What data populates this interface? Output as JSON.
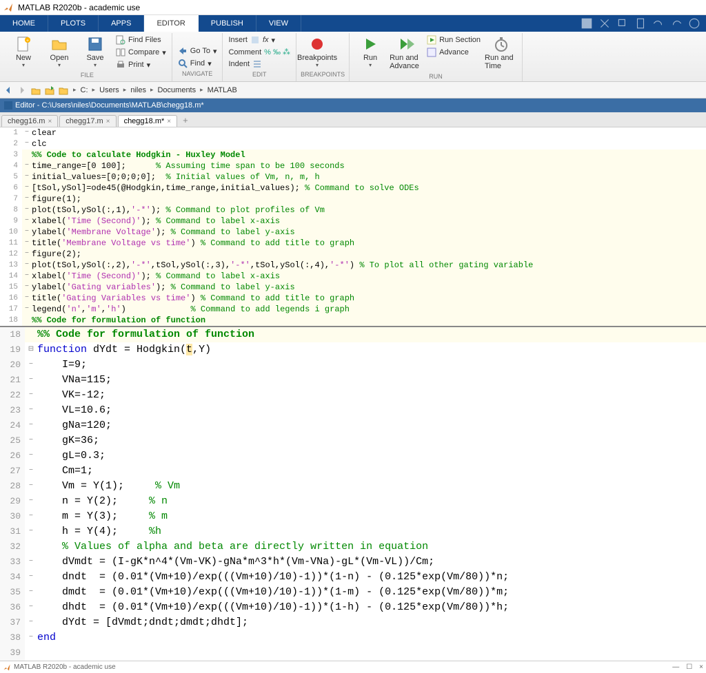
{
  "window": {
    "title": "MATLAB R2020b - academic use"
  },
  "tabs": {
    "home": "HOME",
    "plots": "PLOTS",
    "apps": "APPS",
    "editor": "EDITOR",
    "publish": "PUBLISH",
    "view": "VIEW"
  },
  "ribbon": {
    "new": "New",
    "open": "Open",
    "save": "Save",
    "findfiles": "Find Files",
    "compare": "Compare",
    "print": "Print",
    "goto": "Go To",
    "find": "Find",
    "comment": "Comment",
    "indent": "Indent",
    "insert": "Insert",
    "breakpoints": "Breakpoints",
    "run": "Run",
    "runadvance": "Run and Advance",
    "runsection": "Run Section",
    "advance": "Advance",
    "runtime": "Run and Time",
    "g_file": "FILE",
    "g_navigate": "NAVIGATE",
    "g_edit": "EDIT",
    "g_breakpoints": "BREAKPOINTS",
    "g_run": "RUN"
  },
  "breadcrumb": {
    "c": "C:",
    "users": "Users",
    "niles": "niles",
    "documents": "Documents",
    "matlab": "MATLAB"
  },
  "editorbar": "Editor - C:\\Users\\niles\\Documents\\MATLAB\\chegg18.m*",
  "filetabs": {
    "t1": "chegg16.m",
    "t2": "chegg17.m",
    "t3": "chegg18.m*"
  },
  "code1": {
    "l1": "clear",
    "l2": "clc",
    "l3": "%% Code to calculate Hodgkin - Huxley Model",
    "l4a": "time_range=[0 100];      ",
    "l4b": "% Assuming time span to be 100 seconds",
    "l5a": "initial_values=[0;0;0;0];  ",
    "l5b": "% Initial values of Vm, n, m, h",
    "l6a": "[tSol,ySol]=ode45(@Hodgkin,time_range,initial_values); ",
    "l6b": "% Command to solve ODEs",
    "l7": "figure(1);",
    "l8a": "plot(tSol,ySol(:,1),",
    "l8s": "'-*'",
    "l8b": "); ",
    "l8c": "% Command to plot profiles of Vm",
    "l9a": "xlabel(",
    "l9s": "'Time (Second)'",
    "l9b": "); ",
    "l9c": "% Command to label x-axis",
    "l10a": "ylabel(",
    "l10s": "'Membrane Voltage'",
    "l10b": "); ",
    "l10c": "% Command to label y-axis",
    "l11a": "title(",
    "l11s": "'Membrane Voltage vs time'",
    "l11b": ") ",
    "l11c": "% Command to add title to graph",
    "l12": "figure(2);",
    "l13a": "plot(tSol,ySol(:,2),",
    "l13s1": "'-*'",
    "l13b": ",tSol,ySol(:,3),",
    "l13s2": "'-*'",
    "l13c": ",tSol,ySol(:,4),",
    "l13s3": "'-*'",
    "l13d": ") ",
    "l13e": "% To plot all other gating variable",
    "l14a": "xlabel(",
    "l14s": "'Time (Second)'",
    "l14b": "); ",
    "l14c": "% Command to label x-axis",
    "l15a": "ylabel(",
    "l15s": "'Gating variables'",
    "l15b": "); ",
    "l15c": "% Command to label y-axis",
    "l16a": "title(",
    "l16s": "'Gating Variables vs time'",
    "l16b": ") ",
    "l16c": "% Command to add title to graph",
    "l17a": "legend(",
    "l17s1": "'n'",
    "l17b": ",",
    "l17s2": "'m'",
    "l17c": ",",
    "l17s3": "'h'",
    "l17d": ")             ",
    "l17e": "% Command to add legends i graph",
    "l18": "%% Code for formulation of function"
  },
  "code2": {
    "l18": "%% Code for formulation of function",
    "l19a": "function",
    "l19b": " dYdt = Hodgkin(",
    "l19c": "t",
    "l19d": ",Y)",
    "l20": "    I=9;",
    "l21": "    VNa=115;",
    "l22": "    VK=-12;",
    "l23": "    VL=10.6;",
    "l24": "    gNa=120;",
    "l25": "    gK=36;",
    "l26": "    gL=0.3;",
    "l27": "    Cm=1;",
    "l28a": "    Vm = Y(1);     ",
    "l28b": "% Vm",
    "l29a": "    n = Y(2);     ",
    "l29b": "% n",
    "l30a": "    m = Y(3);     ",
    "l30b": "% m",
    "l31a": "    h = Y(4);     ",
    "l31b": "%h",
    "l32": "    % Values of alpha and beta are directly written in equation",
    "l33": "    dVmdt = (I-gK*n^4*(Vm-VK)-gNa*m^3*h*(Vm-VNa)-gL*(Vm-VL))/Cm;",
    "l34": "    dndt  = (0.01*(Vm+10)/exp(((Vm+10)/10)-1))*(1-n) - (0.125*exp(Vm/80))*n;",
    "l35": "    dmdt  = (0.01*(Vm+10)/exp(((Vm+10)/10)-1))*(1-m) - (0.125*exp(Vm/80))*m;",
    "l36": "    dhdt  = (0.01*(Vm+10)/exp(((Vm+10)/10)-1))*(1-h) - (0.125*exp(Vm/80))*h;",
    "l37": "    dYdt = [dVmdt;dndt;dmdt;dhdt];",
    "l38": "end"
  },
  "bottom": {
    "title": "MATLAB R2020b - academic use"
  }
}
